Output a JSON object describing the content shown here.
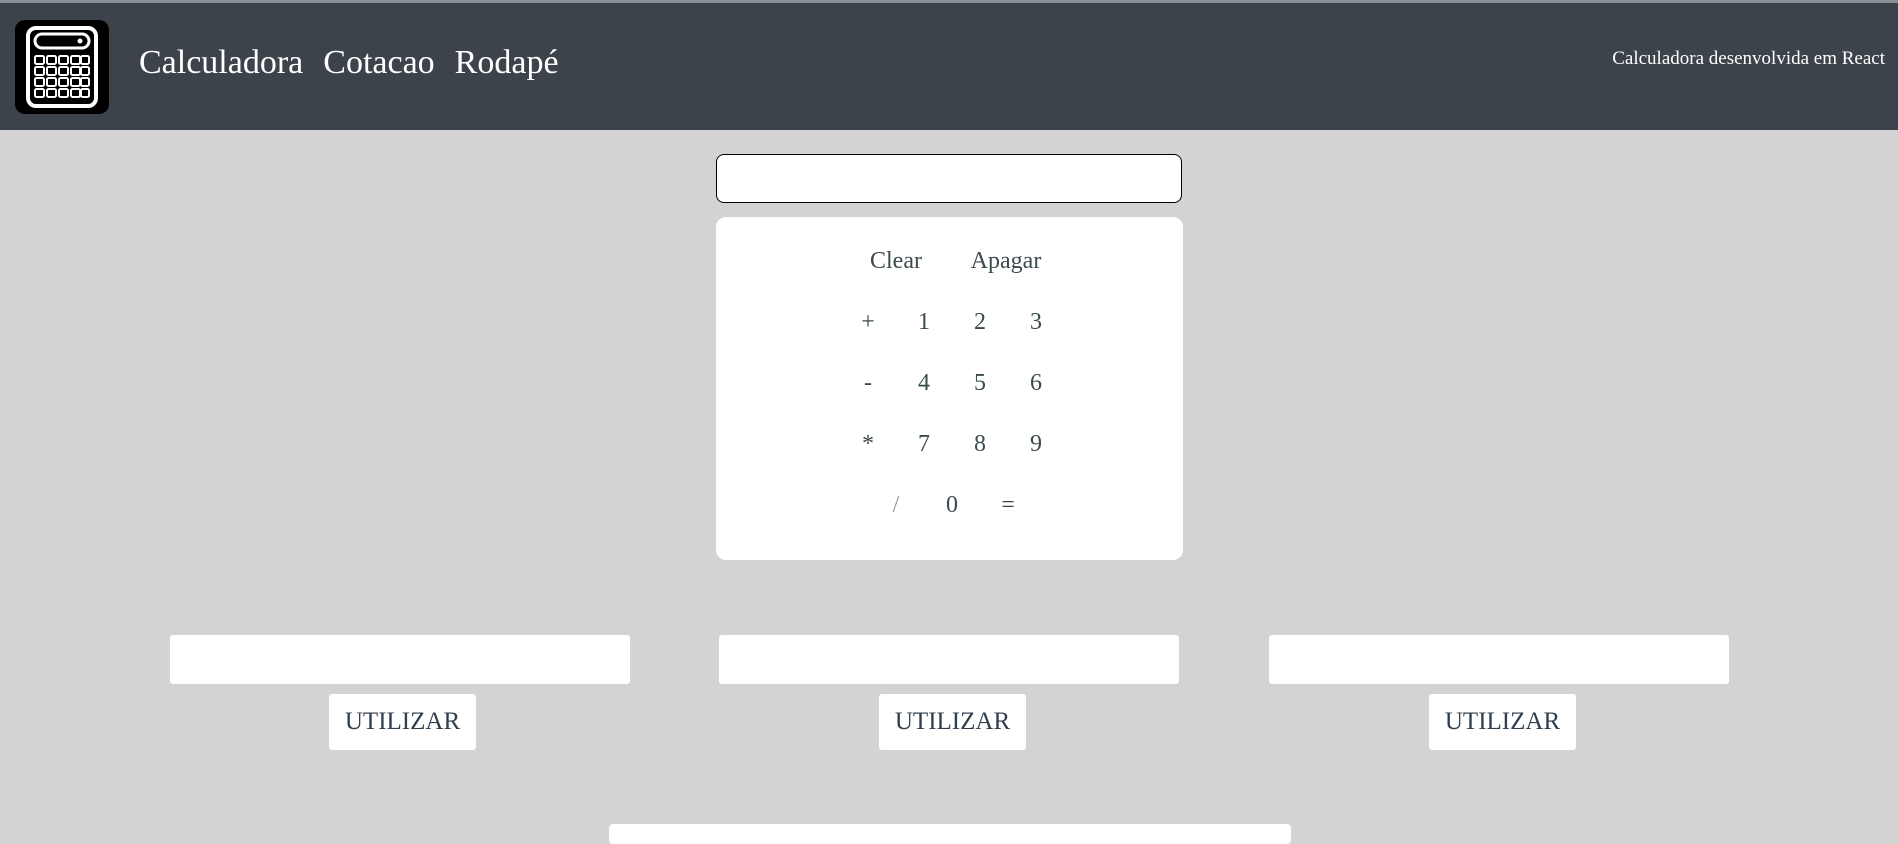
{
  "navbar": {
    "links": [
      {
        "label": "Calculadora"
      },
      {
        "label": "Cotacao"
      },
      {
        "label": "Rodapé"
      }
    ],
    "description": "Calculadora desenvolvida em React"
  },
  "calculator": {
    "display_value": "",
    "keys": {
      "clear": "Clear",
      "backspace": "Apagar",
      "plus": "+",
      "minus": "-",
      "multiply": "*",
      "divide": "/",
      "equals": "=",
      "d0": "0",
      "d1": "1",
      "d2": "2",
      "d3": "3",
      "d4": "4",
      "d5": "5",
      "d6": "6",
      "d7": "7",
      "d8": "8",
      "d9": "9"
    }
  },
  "conversion": {
    "inputs": [
      {
        "value": ""
      },
      {
        "value": ""
      },
      {
        "value": ""
      }
    ],
    "button_label": "UTILIZAR"
  },
  "colors": {
    "background": "#d3d3d3",
    "navbar": "#3c434b",
    "key_text": "#3b4a4e"
  },
  "icons": {
    "logo": "calculator-icon"
  }
}
